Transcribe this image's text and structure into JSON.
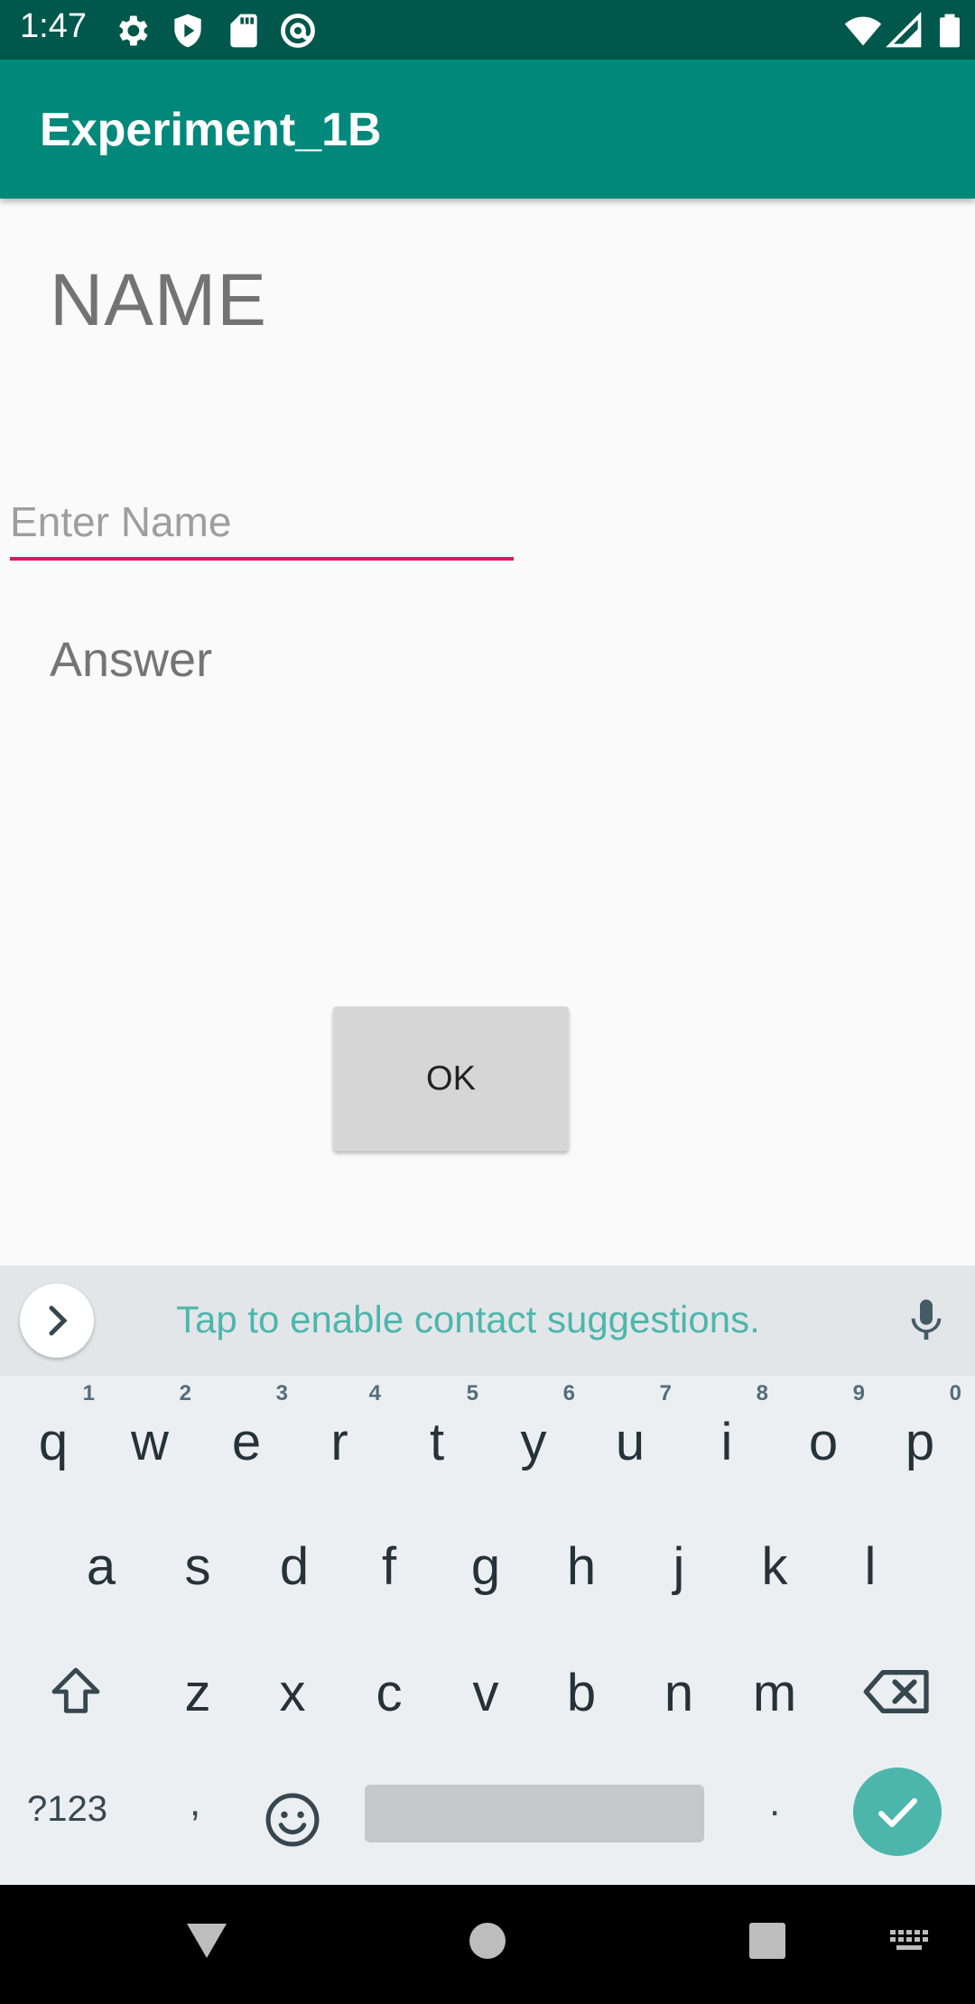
{
  "status_bar": {
    "time": "1:47",
    "left_icons": [
      "settings-icon",
      "shield-play-icon",
      "sd-card-icon",
      "at-sign-icon"
    ],
    "right_icons": [
      "wifi-icon",
      "signal-icon",
      "battery-icon"
    ]
  },
  "app_bar": {
    "title": "Experiment_1B"
  },
  "main": {
    "name_label": "NAME",
    "name_input": {
      "placeholder": "Enter Name",
      "value": ""
    },
    "answer_label": "Answer",
    "ok_button": "OK"
  },
  "keyboard": {
    "suggestion_text": "Tap to enable contact suggestions.",
    "row1": [
      {
        "key": "q",
        "hint": "1"
      },
      {
        "key": "w",
        "hint": "2"
      },
      {
        "key": "e",
        "hint": "3"
      },
      {
        "key": "r",
        "hint": "4"
      },
      {
        "key": "t",
        "hint": "5"
      },
      {
        "key": "y",
        "hint": "6"
      },
      {
        "key": "u",
        "hint": "7"
      },
      {
        "key": "i",
        "hint": "8"
      },
      {
        "key": "o",
        "hint": "9"
      },
      {
        "key": "p",
        "hint": "0"
      }
    ],
    "row2": [
      "a",
      "s",
      "d",
      "f",
      "g",
      "h",
      "j",
      "k",
      "l"
    ],
    "row3": [
      "z",
      "x",
      "c",
      "v",
      "b",
      "n",
      "m"
    ],
    "symbols_key": "?123",
    "comma_key": ",",
    "period_key": ".",
    "accent_color": "#4db6ac"
  },
  "colors": {
    "status_bar": "#00574b",
    "app_bar": "#00897b",
    "input_underline": "#d81b60"
  }
}
